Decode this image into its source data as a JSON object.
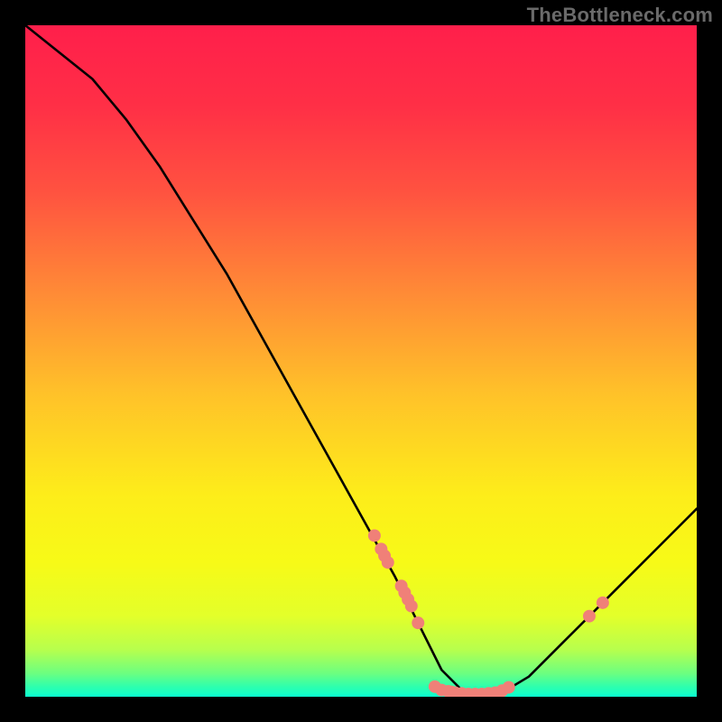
{
  "watermark": "TheBottleneck.com",
  "chart_data": {
    "type": "line",
    "title": "",
    "xlabel": "",
    "ylabel": "",
    "xlim": [
      0,
      100
    ],
    "ylim": [
      0,
      100
    ],
    "grid": false,
    "curve_note": "V-shaped bottleneck curve. Starts top-left near y≈100, descends steeply, reaches a flat valley near y≈0 around x≈62−70, then rises toward the right side to y≈28 at x=100. Values are estimated from pixel positions; no axis tick labels are rendered in the image.",
    "curve": {
      "x": [
        0,
        5,
        10,
        15,
        20,
        25,
        30,
        35,
        40,
        45,
        50,
        55,
        58,
        60,
        62,
        65,
        68,
        70,
        75,
        80,
        85,
        90,
        95,
        100
      ],
      "y": [
        100,
        96,
        92,
        86,
        79,
        71,
        63,
        54,
        45,
        36,
        27,
        18,
        12,
        8,
        4,
        1,
        0,
        0,
        3,
        8,
        13,
        18,
        23,
        28
      ]
    },
    "markers_note": "Coral circular markers clustered on the curve near the descent floor and along the low valley, plus a pair on the rising segment near x≈85. Coordinates estimated.",
    "markers": [
      {
        "x": 52,
        "y": 24
      },
      {
        "x": 53,
        "y": 22
      },
      {
        "x": 53.5,
        "y": 21
      },
      {
        "x": 54,
        "y": 20
      },
      {
        "x": 56,
        "y": 16.5
      },
      {
        "x": 56.5,
        "y": 15.5
      },
      {
        "x": 57,
        "y": 14.5
      },
      {
        "x": 57.5,
        "y": 13.5
      },
      {
        "x": 58.5,
        "y": 11
      },
      {
        "x": 61,
        "y": 1.5
      },
      {
        "x": 62,
        "y": 1
      },
      {
        "x": 63,
        "y": 0.8
      },
      {
        "x": 63.5,
        "y": 0.7
      },
      {
        "x": 64,
        "y": 0.6
      },
      {
        "x": 65,
        "y": 0.5
      },
      {
        "x": 66,
        "y": 0.4
      },
      {
        "x": 67,
        "y": 0.4
      },
      {
        "x": 68,
        "y": 0.4
      },
      {
        "x": 69,
        "y": 0.5
      },
      {
        "x": 70,
        "y": 0.6
      },
      {
        "x": 71,
        "y": 0.9
      },
      {
        "x": 72,
        "y": 1.4
      },
      {
        "x": 84,
        "y": 12
      },
      {
        "x": 86,
        "y": 14
      }
    ],
    "background_gradient": {
      "type": "vertical-linear",
      "stops": [
        {
          "pos": 0.0,
          "color": "#ff1f4b"
        },
        {
          "pos": 0.12,
          "color": "#ff2f46"
        },
        {
          "pos": 0.25,
          "color": "#ff5340"
        },
        {
          "pos": 0.4,
          "color": "#ff8b36"
        },
        {
          "pos": 0.55,
          "color": "#ffc229"
        },
        {
          "pos": 0.7,
          "color": "#fded1a"
        },
        {
          "pos": 0.8,
          "color": "#f7fa17"
        },
        {
          "pos": 0.88,
          "color": "#e3ff2a"
        },
        {
          "pos": 0.93,
          "color": "#b7ff4d"
        },
        {
          "pos": 0.965,
          "color": "#6cff80"
        },
        {
          "pos": 0.985,
          "color": "#2effad"
        },
        {
          "pos": 1.0,
          "color": "#0affd0"
        }
      ]
    },
    "curve_color": "#000000",
    "marker_color": "#f08078",
    "marker_radius": 7
  }
}
